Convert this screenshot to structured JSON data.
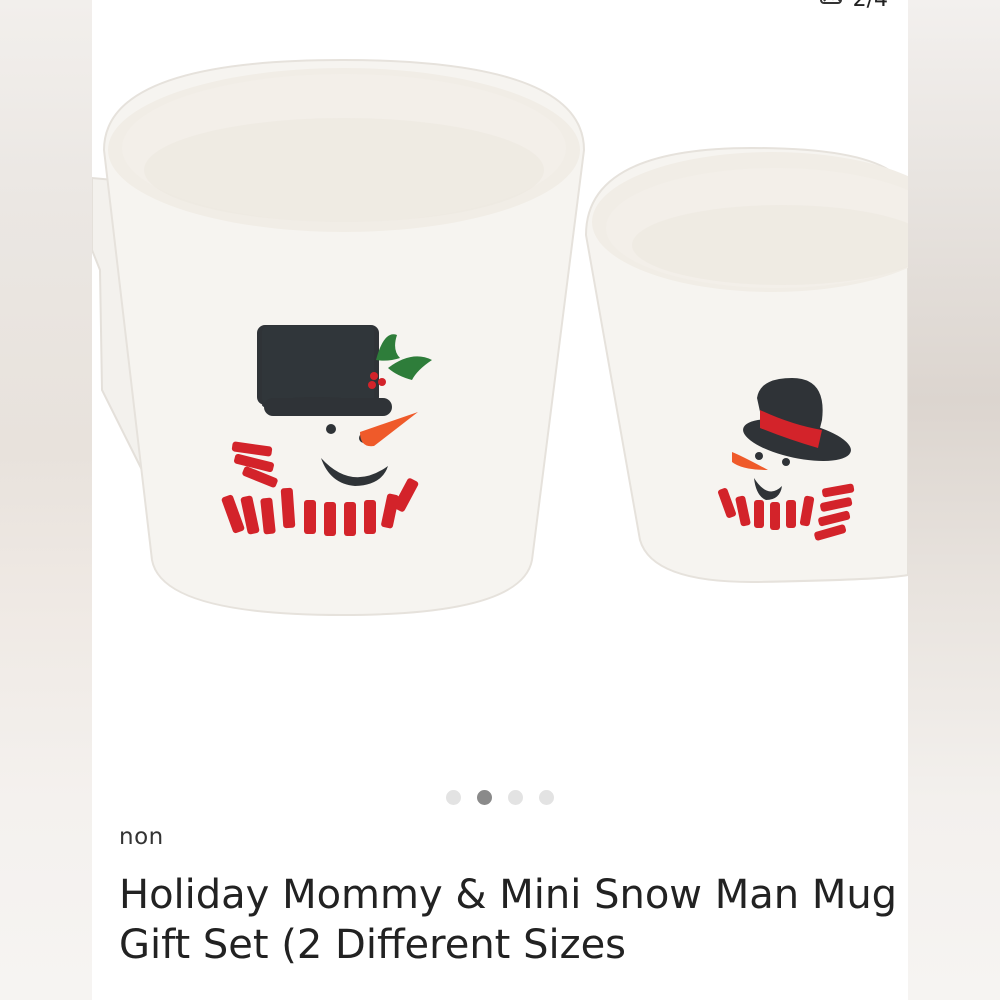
{
  "counter": {
    "text": "2/4",
    "icon": "image-stack-icon"
  },
  "pagination": {
    "count": 4,
    "active_index": 1
  },
  "listing": {
    "brand": "non",
    "title": "Holiday Mommy & Mini Snow Man Mug Gift Set (2 Different Sizes"
  },
  "colors": {
    "accent_red": "#d3232a",
    "hat": "#2f3337",
    "holly": "#2e7d3a",
    "mug": "#f7f5f1"
  }
}
